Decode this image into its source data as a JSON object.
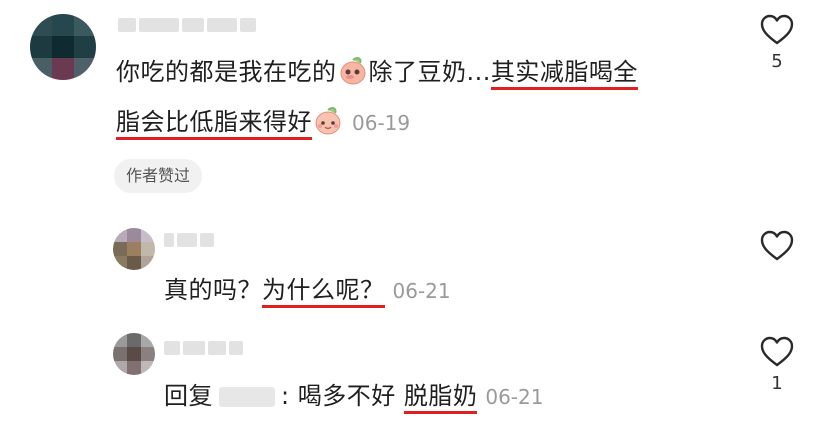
{
  "comments": [
    {
      "text_line1_a": "你吃的都是我在吃的",
      "text_line1_b": "除了豆奶...",
      "text_line1_c": "其实减脂喝全",
      "text_line2_a": "脂会比低脂来得好",
      "date": "06-19",
      "author_liked_label": "作者赞过",
      "like_count": "5"
    },
    {
      "text_a": "真的吗？",
      "text_b": "为什么呢？",
      "date": "06-21",
      "like_count": ""
    },
    {
      "reply_prefix": "回复",
      "text_a": ": 喝多不好",
      "text_b": "脱脂奶",
      "date": "06-21",
      "like_count": "1"
    }
  ],
  "colors": {
    "underline": "#e02020",
    "date": "#9a9a9a",
    "text": "#1f1f1f"
  },
  "icons": [
    "heart-outline-icon",
    "peach-emoji-icon"
  ]
}
